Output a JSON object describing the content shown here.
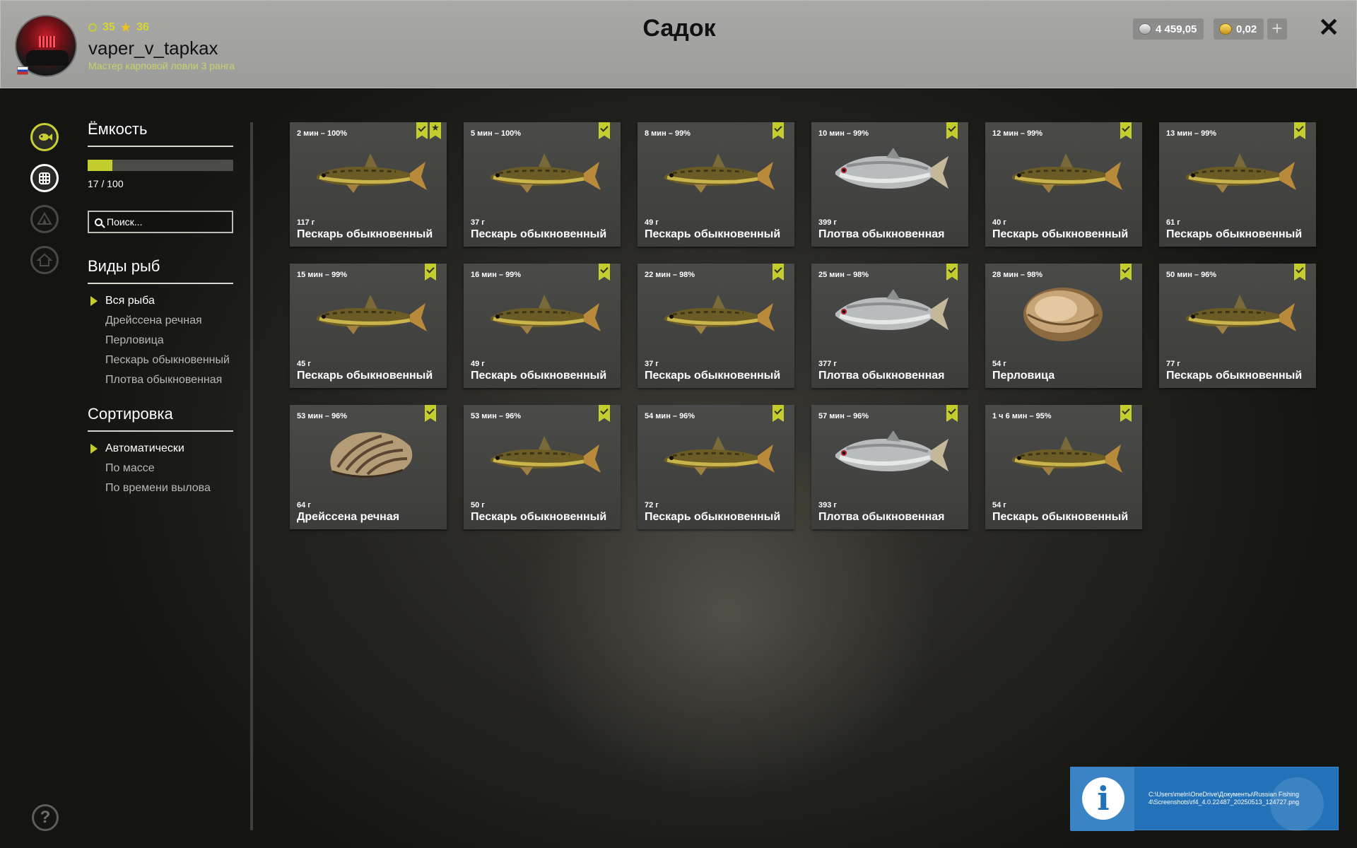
{
  "header": {
    "title": "Садок",
    "level": "35",
    "stars": "36",
    "username": "vaper_v_tapkax",
    "rank": "Мастер карповой ловли 3 ранга",
    "silver": "4 459,05",
    "gold": "0,02"
  },
  "capacity": {
    "label": "Ёмкость",
    "value": "17 / 100",
    "fill_fraction": 0.17
  },
  "search": {
    "placeholder": "Поиск..."
  },
  "species": {
    "label": "Виды рыб",
    "items": [
      "Вся рыба",
      "Дрейссена речная",
      "Перловица",
      "Пескарь обыкновенный",
      "Плотва обыкновенная"
    ],
    "selected": 0
  },
  "sort": {
    "label": "Сортировка",
    "items": [
      "Автоматически",
      "По массе",
      "По времени вылова"
    ],
    "selected": 0
  },
  "catches": [
    {
      "time": "2 мин – 100%",
      "weight": "117 г",
      "name": "Пескарь обыкновенный",
      "kind": "gudgeon",
      "star": true
    },
    {
      "time": "5 мин – 100%",
      "weight": "37 г",
      "name": "Пескарь обыкновенный",
      "kind": "gudgeon",
      "star": false
    },
    {
      "time": "8 мин – 99%",
      "weight": "49 г",
      "name": "Пескарь обыкновенный",
      "kind": "gudgeon",
      "star": false
    },
    {
      "time": "10 мин – 99%",
      "weight": "399 г",
      "name": "Плотва обыкновенная",
      "kind": "roach",
      "star": false
    },
    {
      "time": "12 мин – 99%",
      "weight": "40 г",
      "name": "Пескарь обыкновенный",
      "kind": "gudgeon",
      "star": false
    },
    {
      "time": "13 мин – 99%",
      "weight": "61 г",
      "name": "Пескарь обыкновенный",
      "kind": "gudgeon",
      "star": false
    },
    {
      "time": "15 мин – 99%",
      "weight": "45 г",
      "name": "Пескарь обыкновенный",
      "kind": "gudgeon",
      "star": false
    },
    {
      "time": "16 мин – 99%",
      "weight": "49 г",
      "name": "Пескарь обыкновенный",
      "kind": "gudgeon",
      "star": false
    },
    {
      "time": "22 мин – 98%",
      "weight": "37 г",
      "name": "Пескарь обыкновенный",
      "kind": "gudgeon",
      "star": false
    },
    {
      "time": "25 мин – 98%",
      "weight": "377 г",
      "name": "Плотва обыкновенная",
      "kind": "roach",
      "star": false
    },
    {
      "time": "28 мин – 98%",
      "weight": "54 г",
      "name": "Перловица",
      "kind": "mussel",
      "star": false
    },
    {
      "time": "50 мин – 96%",
      "weight": "77 г",
      "name": "Пескарь обыкновенный",
      "kind": "gudgeon",
      "star": false
    },
    {
      "time": "53 мин – 96%",
      "weight": "64 г",
      "name": "Дрейссена речная",
      "kind": "zebra",
      "star": false
    },
    {
      "time": "53 мин – 96%",
      "weight": "50 г",
      "name": "Пескарь обыкновенный",
      "kind": "gudgeon",
      "star": false
    },
    {
      "time": "54 мин – 96%",
      "weight": "72 г",
      "name": "Пескарь обыкновенный",
      "kind": "gudgeon",
      "star": false
    },
    {
      "time": "57 мин – 96%",
      "weight": "393 г",
      "name": "Плотва обыкновенная",
      "kind": "roach",
      "star": false
    },
    {
      "time": "1 ч 6 мин – 95%",
      "weight": "54 г",
      "name": "Пескарь обыкновенный",
      "kind": "gudgeon",
      "star": false
    }
  ],
  "notification": {
    "text": "C:\\Users\\meln\\OneDrive\\Документы\\Russian Fishing 4\\Screenshots\\rf4_4.0.22487_20250513_124727.png",
    "icon": "info-icon"
  },
  "icons": {
    "rail": [
      "fish-icon",
      "keepnet-icon",
      "tent-icon",
      "home-icon"
    ],
    "help": "?",
    "close": "✕",
    "plus": "+"
  }
}
